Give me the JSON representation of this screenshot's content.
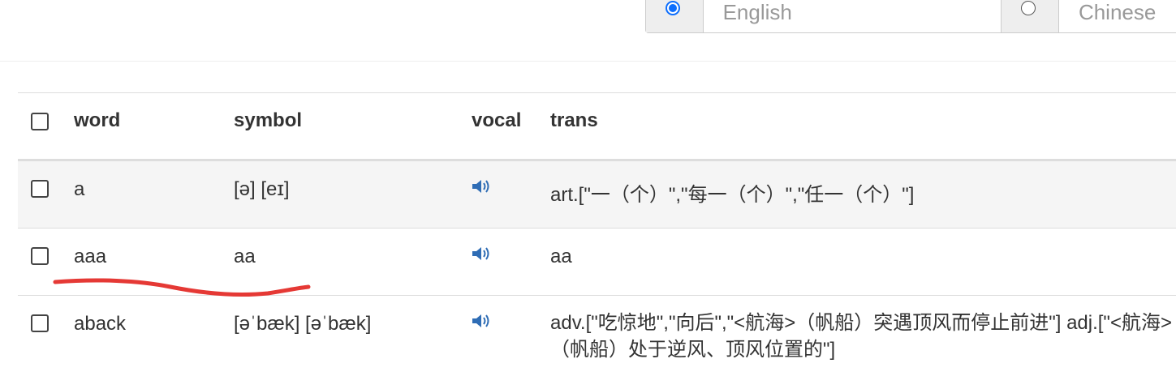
{
  "language_toggle": {
    "options": [
      {
        "label": "English",
        "selected": true
      },
      {
        "label": "Chinese",
        "selected": false
      }
    ],
    "accent_color": "#0d6efd"
  },
  "table": {
    "headers": {
      "word": "word",
      "symbol": "symbol",
      "vocal": "vocal",
      "trans": "trans"
    },
    "rows": [
      {
        "word": "a",
        "symbol": "[ə] [eɪ]",
        "vocal_icon": "speaker-icon",
        "trans": "art.[\"一（个）\",\"每一（个）\",\"任一（个）\"]"
      },
      {
        "word": "aaa",
        "symbol": "aa",
        "vocal_icon": "speaker-icon",
        "trans": "aa"
      },
      {
        "word": "aback",
        "symbol": "[əˈbæk] [əˈbæk]",
        "vocal_icon": "speaker-icon",
        "trans": "adv.[\"吃惊地\",\"向后\",\"<航海>（帆船）突遇顶风而停止前进\"] adj.[\"<航海>（帆船）处于逆风、顶风位置的\"]"
      }
    ]
  },
  "annotation": {
    "color": "#e53935"
  }
}
